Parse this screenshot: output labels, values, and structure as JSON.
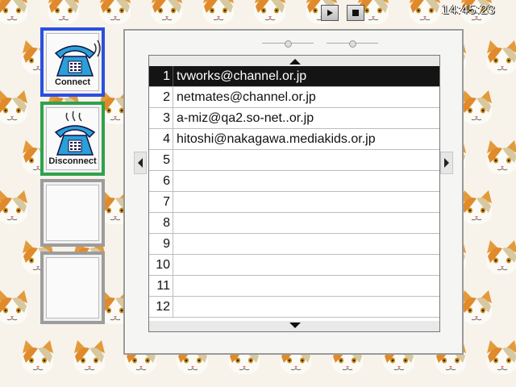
{
  "clock": "14:45:23",
  "transport": {
    "play_icon": "play-icon",
    "stop_icon": "stop-icon"
  },
  "buttons": {
    "connect_label": "Connect",
    "disconnect_label": "Disconnect"
  },
  "list": {
    "rows": [
      {
        "num": "1",
        "address": "tvworks@channel.or.jp"
      },
      {
        "num": "2",
        "address": "netmates@channel.or.jp"
      },
      {
        "num": "3",
        "address": "a-miz@qa2.so-net..or.jp"
      },
      {
        "num": "4",
        "address": "hitoshi@nakagawa.mediakids.or.jp"
      },
      {
        "num": "5",
        "address": ""
      },
      {
        "num": "6",
        "address": ""
      },
      {
        "num": "7",
        "address": ""
      },
      {
        "num": "8",
        "address": ""
      },
      {
        "num": "9",
        "address": ""
      },
      {
        "num": "10",
        "address": ""
      },
      {
        "num": "11",
        "address": ""
      },
      {
        "num": "12",
        "address": ""
      }
    ],
    "selected_row": 1
  },
  "colors": {
    "connect_border": "#2b4fe0",
    "disconnect_border": "#2fa24a",
    "phone_blue": "#2aa0d8"
  }
}
